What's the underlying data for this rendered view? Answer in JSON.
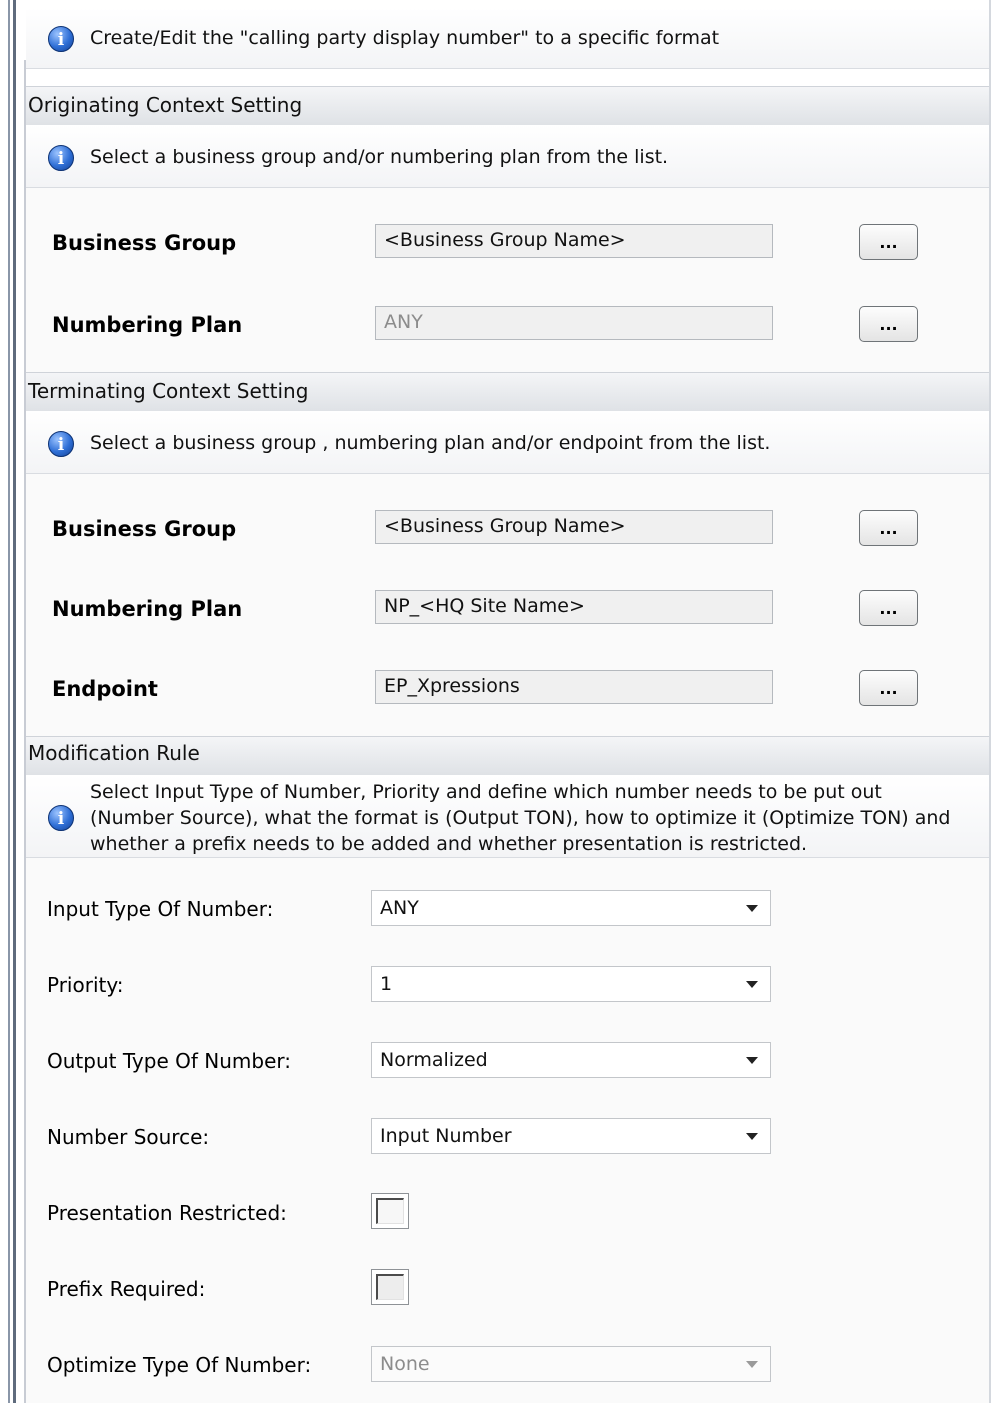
{
  "header": {
    "info": "Create/Edit the \"calling party display number\" to a specific format"
  },
  "originating": {
    "title": "Originating Context Setting",
    "info": "Select a business group and/or numbering plan from the list.",
    "business_group_label": "Business Group",
    "business_group_value": "<Business Group Name>",
    "numbering_plan_label": "Numbering Plan",
    "numbering_plan_value": "ANY",
    "browse_label": "..."
  },
  "terminating": {
    "title": "Terminating Context Setting",
    "info": "Select a business group , numbering plan and/or endpoint from the list.",
    "business_group_label": "Business Group",
    "business_group_value": "<Business Group Name>",
    "numbering_plan_label": "Numbering Plan",
    "numbering_plan_value": "NP_<HQ Site Name>",
    "endpoint_label": "Endpoint",
    "endpoint_value": "EP_Xpressions",
    "browse_label": "..."
  },
  "modification": {
    "title": "Modification Rule",
    "info": "Select Input Type of Number, Priority and define which number needs to be put out (Number Source), what the format is (Output TON), how to optimize it (Optimize TON) and whether a prefix needs to be added and whether presentation is restricted.",
    "input_ton_label": "Input Type Of Number:",
    "input_ton_value": "ANY",
    "priority_label": "Priority:",
    "priority_value": "1",
    "output_ton_label": "Output Type Of Number:",
    "output_ton_value": "Normalized",
    "number_source_label": "Number Source:",
    "number_source_value": "Input Number",
    "presentation_restricted_label": "Presentation Restricted:",
    "presentation_restricted_checked": false,
    "prefix_required_label": "Prefix Required:",
    "prefix_required_checked": false,
    "optimize_ton_label": "Optimize Type Of Number:",
    "optimize_ton_value": "None"
  },
  "icons": {
    "info": "info-icon",
    "dropdown": "chevron-down-icon"
  },
  "colors": {
    "info_icon": "#2f6fd6",
    "section_header": "#e4e6ea"
  }
}
